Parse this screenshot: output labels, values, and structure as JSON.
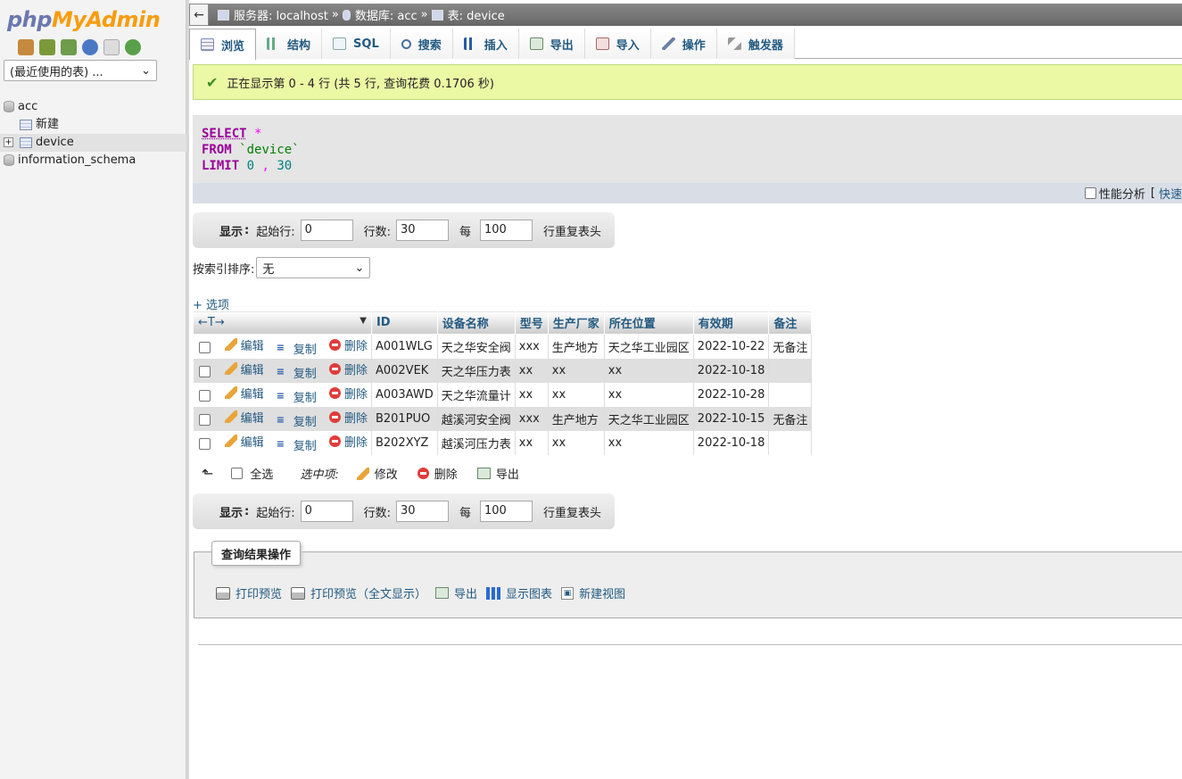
{
  "nav": {
    "logo_php": "php",
    "logo_myadmin": "MyAdmin",
    "recent_select": "(最近使用的表) ...",
    "tree": [
      {
        "label": "acc",
        "type": "db"
      },
      {
        "label": "新建",
        "type": "new"
      },
      {
        "label": "device",
        "type": "table"
      },
      {
        "label": "information_schema",
        "type": "db"
      }
    ]
  },
  "breadcrumb": {
    "server": "服务器: localhost",
    "database": "数据库: acc",
    "table": "表: device",
    "sep": "»"
  },
  "tabs": [
    "浏览",
    "结构",
    "SQL",
    "搜索",
    "插入",
    "导出",
    "导入",
    "操作",
    "触发器"
  ],
  "success_message": "正在显示第 0 - 4 行 (共 5 行, 查询花费 0.1706 秒)",
  "sql": {
    "select": "SELECT",
    "star": "*",
    "from": "FROM",
    "table": "`device`",
    "limit": "LIMIT",
    "limit_start": "0",
    "comma": ",",
    "limit_count": "30"
  },
  "sqlbar": {
    "profiling": "性能分析",
    "bracket": "[",
    "quick_edit": "快速"
  },
  "navigation": {
    "show": "显示",
    "colon": ":",
    "start_row_label": "起始行:",
    "start_row": "0",
    "rows_label": "行数:",
    "rows": "30",
    "every_label": "每",
    "every": "100",
    "repeat_header": "行重复表头"
  },
  "sort": {
    "label": "按索引排序:",
    "value": "无"
  },
  "options_link": "+ 选项",
  "table": {
    "nav_arrows": "←T→",
    "headers": [
      "ID",
      "设备名称",
      "型号",
      "生产厂家",
      "所在位置",
      "有效期",
      "备注"
    ],
    "actions": {
      "edit": "编辑",
      "copy": "复制",
      "delete": "删除"
    },
    "rows": [
      [
        "A001WLG",
        "天之华安全阀",
        "xxx",
        "生产地方",
        "天之华工业园区",
        "2022-10-22",
        "无备注"
      ],
      [
        "A002VEK",
        "天之华压力表",
        "xx",
        "xx",
        "xx",
        "2022-10-18",
        ""
      ],
      [
        "A003AWD",
        "天之华流量计",
        "xx",
        "xx",
        "xx",
        "2022-10-28",
        ""
      ],
      [
        "B201PUO",
        "越溪河安全阀",
        "xxx",
        "生产地方",
        "天之华工业园区",
        "2022-10-15",
        "无备注"
      ],
      [
        "B202XYZ",
        "越溪河压力表",
        "xx",
        "xx",
        "xx",
        "2022-10-18",
        ""
      ]
    ]
  },
  "bulk": {
    "select_all": "全选",
    "with_selected": "选中项:",
    "modify": "修改",
    "delete": "删除",
    "export": "导出"
  },
  "query_ops": {
    "legend": "查询结果操作",
    "print": "打印预览",
    "print_full": "打印预览（全文显示）",
    "export": "导出",
    "chart": "显示图表",
    "create_view": "新建视图"
  }
}
